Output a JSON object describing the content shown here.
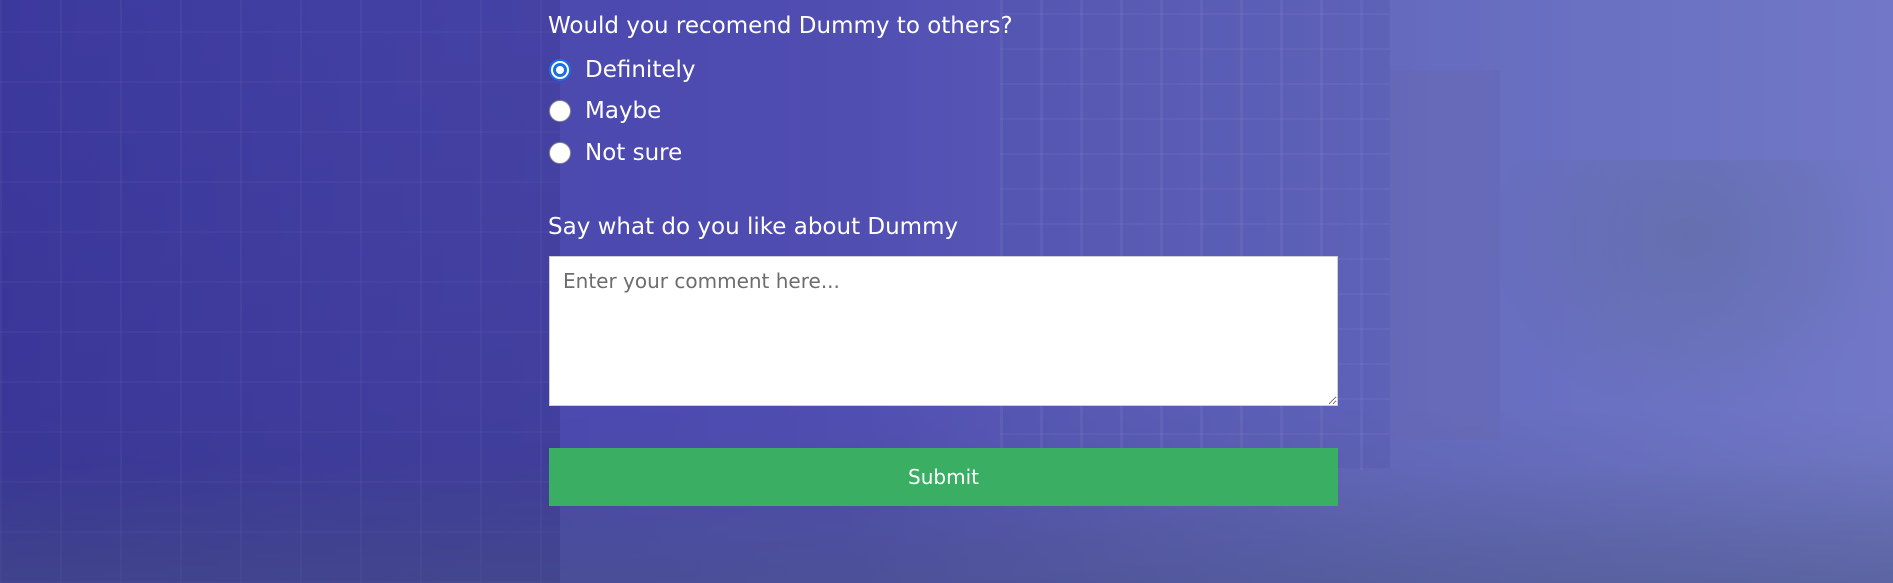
{
  "survey": {
    "question": "Would you recomend Dummy to others?",
    "options": [
      {
        "label": "Definitely",
        "checked": true
      },
      {
        "label": "Maybe",
        "checked": false
      },
      {
        "label": "Not sure",
        "checked": false
      }
    ],
    "comment_label": "Say what do you like about Dummy",
    "comment_placeholder": "Enter your comment here...",
    "comment_value": "",
    "submit_label": "Submit"
  },
  "colors": {
    "overlay": "#4a48a8",
    "submit_bg": "#3aae63",
    "radio_checked": "#1a6fe8",
    "text": "#ffffff"
  }
}
